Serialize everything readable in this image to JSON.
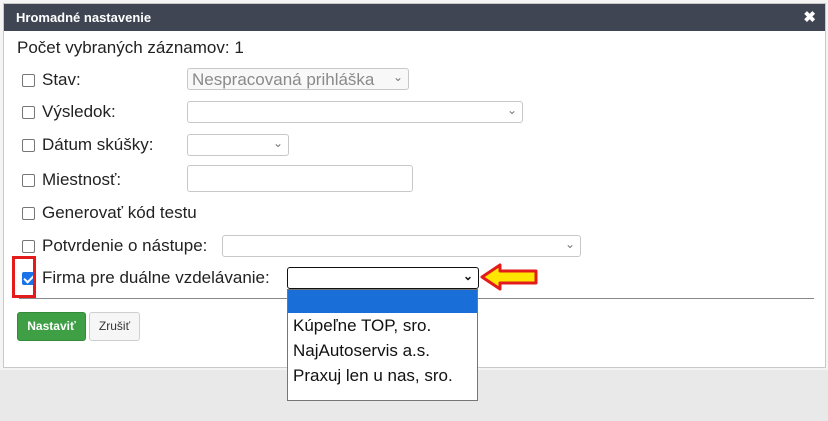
{
  "dialog": {
    "title": "Hromadné nastavenie",
    "close_icon": "close-x-icon"
  },
  "count_line": "Počet vybraných záznamov: 1",
  "fields": [
    {
      "label": "Stav:",
      "checked": false,
      "value": "Nespracovaná prihláška"
    },
    {
      "label": "Výsledok:",
      "checked": false,
      "value": ""
    },
    {
      "label": "Dátum skúšky:",
      "checked": false,
      "value": ""
    },
    {
      "label": "Miestnosť:",
      "checked": false,
      "value": ""
    },
    {
      "label": "Generovať kód testu",
      "checked": false
    },
    {
      "label": "Potvrdenie o nástupe:",
      "checked": false,
      "value": ""
    },
    {
      "label": "Firma pre duálne vzdelávanie:",
      "checked": true,
      "value": ""
    }
  ],
  "firm_dropdown": {
    "options": [
      "",
      "Kúpeľne TOP, sro.",
      "NajAutoservis a.s.",
      "Praxuj len u nas, sro."
    ],
    "highlighted_index": 0
  },
  "buttons": {
    "submit": "Nastaviť",
    "cancel": "Zrušiť"
  },
  "colors": {
    "titlebar": "#3f4552",
    "primary_button": "#3e9f45",
    "highlight_red": "#e31b1b",
    "arrow_yellow": "#ffe600",
    "selected_option": "#1a6ed8"
  }
}
